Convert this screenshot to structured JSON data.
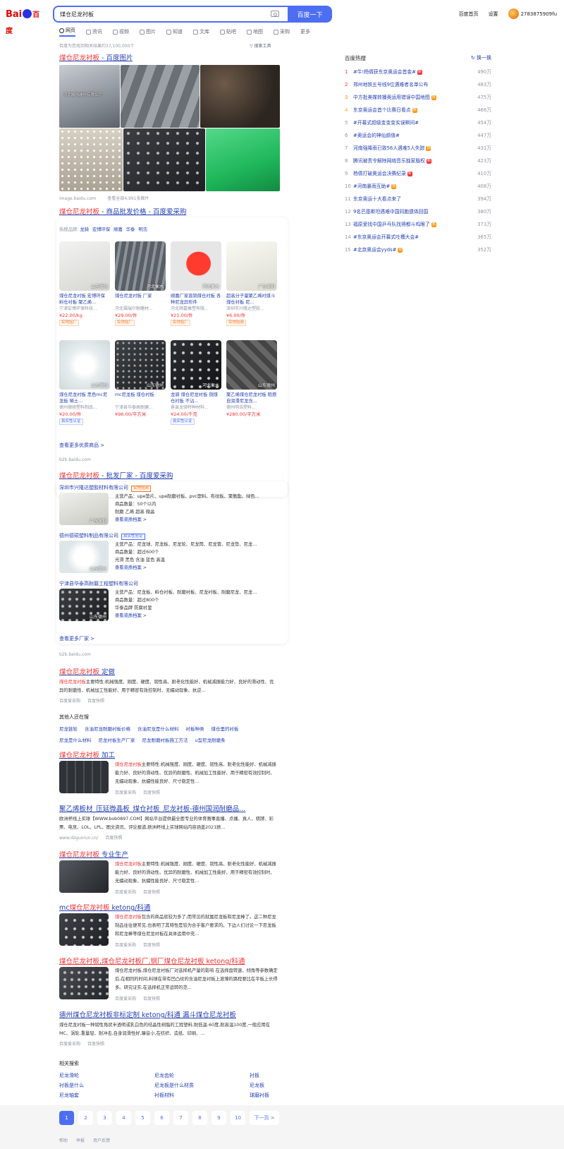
{
  "header": {
    "logo_bai": "Bai",
    "logo_du": "百度",
    "search_value": "煤仓尼龙衬板",
    "search_button": "百度一下",
    "links": [
      "百度首页",
      "设置"
    ],
    "user_name": "2783875909fu"
  },
  "tabs": [
    "网页",
    "资讯",
    "视频",
    "图片",
    "知道",
    "文库",
    "贴吧",
    "地图",
    "采购",
    "更多"
  ],
  "result_count": "百度为您找到相关结果约37,100,000个",
  "search_tools": "搜索工具",
  "image_result": {
    "title_em": "煤仓尼龙衬板",
    "title_rest": " - 百度图片",
    "source": "image.baidu.com",
    "more": "查看全部4,991张图片",
    "labels": [
      "河北曦扬建材有限公司",
      ""
    ]
  },
  "b2b_products": {
    "title_em": "煤仓尼龙衬板",
    "title_rest": " - 商品批发价格 - 百度爱采购",
    "brands_label": "热搜品牌:",
    "brands": [
      "龙骑",
      "宏博环保",
      "顺嘉",
      "华泰",
      "明浩"
    ],
    "cards": [
      {
        "title": "煤仓尼龙衬板 宏博环保 料仓衬板 聚乙烯...",
        "desc": "宁津宏博环保科技...",
        "price": "¥22.00/kg",
        "badge": "实地验厂",
        "badge_type": "orange",
        "loc": "山东德州"
      },
      {
        "title": "煤仓尼龙衬板 厂家",
        "desc": "河北福瑞尔耐磨材...",
        "price": "¥29.00/件",
        "badge": "实地验厂",
        "badge_type": "orange",
        "loc": "河北衡水"
      },
      {
        "title": "顺嘉厂家直销煤仓衬板 各种尼龙异形件",
        "desc": "河北顺嘉橡塑有限...",
        "price": "¥21.00/件",
        "badge": "实地验厂",
        "badge_type": "orange",
        "loc": "河北衡水"
      },
      {
        "title": "超高分子量聚乙烯衬煤斗煤仓衬板 尼...",
        "desc": "深圳市兴隆达塑胶...",
        "price": "¥6.00/件",
        "badge": "实地验商",
        "badge_type": "orange",
        "loc": "广东深圳"
      },
      {
        "title": "煤仓尼龙衬板 黑色mc尼龙板 稀土...",
        "desc": "德州德硕塑料制品...",
        "price": "¥20.00/件",
        "badge": "真实性认证",
        "badge_type": "blue",
        "loc": "山东德州"
      },
      {
        "title": "mc尼龙板 煤仓衬板",
        "desc": "宁津县华泰高耐磨...",
        "price": "¥96.00/平方米",
        "badge": "",
        "badge_type": "",
        "loc": "山东德州"
      },
      {
        "title": "龙骑 煤仓尼龙衬板 铜煤仓衬板 不沾...",
        "desc": "景县龙骑特种材料...",
        "price": "¥24.00/千克",
        "badge": "真实性认证",
        "badge_type": "blue",
        "loc": "河北衡水"
      },
      {
        "title": "聚乙烯煤仓尼龙衬板 阻燃自润滑尼龙含...",
        "desc": "德州明浩塑料...",
        "price": "¥280.00/平方米",
        "badge": "",
        "badge_type": "",
        "loc": "山东德州"
      }
    ],
    "more": "查看更多优质商品 >",
    "source": "b2b.baidu.com"
  },
  "b2b_vendors": {
    "title_em": "煤仓尼龙衬板",
    "title_rest": " - 批发厂家 - 百度爱采购",
    "vendors": [
      {
        "name": "深圳市兴隆达塑胶材料有限公司",
        "badge": "实地验商",
        "badge_type": "orange",
        "products": "主营产品：upe垫片、upe耐磨衬板、pvc塑料、布纹板、聚氨酯、绿色...",
        "count": "商品数量：50个以内",
        "tags": "耐磨    乙烯    超高    微晶",
        "more": "查看资质档案 >",
        "loc": "广东深圳"
      },
      {
        "name": "德州德硕塑料制品有限公司",
        "badge": "真实性验证",
        "badge_type": "blue",
        "products": "主营产品：尼龙球、尼龙板、尼龙轮、尼龙筒、尼龙管、尼龙垫、尼龙...",
        "count": "商品数量：超过600个",
        "tags": "光滑    黑色    含油    蓝色    高温",
        "more": "查看资质档案 >",
        "loc": "山东德州"
      },
      {
        "name": "宁津县华泰高耐磨工程塑料有限公司",
        "badge": "",
        "badge_type": "",
        "products": "主营产品：尼龙板、料仓衬板、耐磨衬板、尼龙衬板、耐磨尼龙、尼龙...",
        "count": "商品数量：超过800个",
        "tags": "华泰品牌    防腐衬里",
        "more": "查看资质档案 >",
        "loc": "山东德州"
      }
    ],
    "more": "查看更多厂家 >",
    "source": "b2b.baidu.com"
  },
  "result_custom": {
    "title_em": "煤仓尼龙衬板",
    "title_rest": " 定做",
    "text_em": "煤仓尼龙衬板",
    "text": "主要特性:机械强度、刚度、硬度、韧性高、耐老化性能好、机械减振能力好、良好的滑动性、优异的耐磨性、机械加工性能好、用于精密有效控制时、无蠕动现象、抗逆...",
    "source": "百度爱采购",
    "snapshot": "百度快照"
  },
  "others_searched": {
    "title": "其他人还在搜",
    "row1": [
      "尼龙链轮",
      "含油尼龙耐磨衬板价格",
      "含油尼龙是什么材料",
      "衬板种类",
      "煤仓里的衬板"
    ],
    "row2": [
      "尼龙是什么材料",
      "尼龙衬板生产厂家",
      "尼龙耐磨衬板施工方法",
      "u型尼龙耐磨条"
    ]
  },
  "result_process": {
    "title_em": "煤仓尼龙衬板",
    "title_rest": " 加工",
    "text_em": "煤仓尼龙衬板",
    "text": "主要特性:机械强度、刚度、硬度、韧性高、耐老化性能好、机械减振能力好、良好的滑动性、优异的耐磨性、机械加工性能好、用于精密有效控制时、无蠕动现象、抗蠕性能良好、尺寸稳定性...",
    "source": "百度爱采购",
    "snapshot": "百度快照"
  },
  "result_ad": {
    "title": "聚乙烯板材_压延微晶板_煤仓衬板_尼龙衬板-德州国润耐磨品...",
    "text": "欧洲杯线上买球【WWW.bob0897.COM】网站平台提供最全面专业的体育赛事直播、点播、真人、棋牌、彩票、电竞、LOL、LPL、图文资讯、评论报道,欧洲杯线上买球网站内容涵盖2021欧...",
    "source": "www.dzguorun.cn/",
    "snapshot": "百度快照"
  },
  "result_pro": {
    "title_em": "煤仓尼龙衬板",
    "title_rest": " 专业生产",
    "text_em": "煤仓尼龙衬板",
    "text": "主要特性:机械强度、刚度、硬度、韧性高、耐老化性能好、机械减振能力好、良好的滑动性、优异的耐磨性、机械加工性能好、用于精密有效控制时、无蠕动现象、抗蠕性能良好、尺寸稳定性...",
    "source": "百度爱采购",
    "snapshot": "百度快照"
  },
  "result_mc": {
    "title_pre": "mc",
    "title_em": "煤仓尼龙衬板",
    "title_rest": " ketong/科通",
    "text_em": "煤仓尼龙衬板",
    "text": "包含的商品就较为多了,而常见的就属尼龙板和尼龙棒了。这二种尼龙制品往往便常见,也表明了其特性是较为合乎客户要求的。下边人们讨论一下尼龙板和尼龙棒等煤仓尼龙衬板在具体运用中充...",
    "source": "百度爱采购",
    "snapshot": "百度快照"
  },
  "result_factory": {
    "title": "煤仓尼龙衬板,煤仓尼龙衬板厂,钢厂煤仓尼龙衬板 ketong/科通",
    "text": "煤仓尼龙衬板,煤仓尼龙衬板厂对选择机产量的影响 在选择盘转速、倾角等参数确定后,在相同的时间,料球在带有凹凸纹的含油尼龙衬板上滚薄的路程要比在平板上长得多。研究证实,在选择机正常运转的范...",
    "source": "百度爱采购",
    "snapshot": "百度快照"
  },
  "result_dezhou": {
    "title": "德州煤仓尼龙衬板非标定制 ketong/科通 漏斗煤仓尼龙衬板",
    "text": "煤仓尼龙衬板一种韧性角状半透明或乳白色的结晶性树脂的工程塑料,耐低温-60度,耐高温100度,一般应用在MC、涡轮,重量轻、耐冲击,自身润滑性好,噪音小,在纺织、造纸、印刷、...",
    "source": "百度爱采购",
    "snapshot": "百度快照"
  },
  "related": {
    "title": "相关搜索",
    "items": [
      "尼龙滑轮",
      "尼龙齿轮",
      "衬板",
      "衬板是什么",
      "尼龙板是什么材质",
      "尼龙板",
      "尼龙轴套",
      "衬板材料",
      "球磨衬板"
    ]
  },
  "hot_list": {
    "title": "百度热搜",
    "refresh": "换一换",
    "items": [
      {
        "rank": "1",
        "text": "#牛!杨倩获东京奥运会首金#",
        "tag": "新",
        "tag_type": "new",
        "count": "490万"
      },
      {
        "rank": "2",
        "text": "郑州地铁五号线9位遇难者名单公布",
        "tag": "",
        "tag_type": "",
        "count": "483万"
      },
      {
        "rank": "3",
        "text": "中方批美媒转播奥运用错误中国地图",
        "tag": "热",
        "tag_type": "hot",
        "count": "475万"
      },
      {
        "rank": "4",
        "text": "东京奥运会首个比赛日看点",
        "tag": "热",
        "tag_type": "hot",
        "count": "466万"
      },
      {
        "rank": "5",
        "text": "#开幕式超级变变变实误瞬间#",
        "tag": "",
        "tag_type": "",
        "count": "454万"
      },
      {
        "rank": "6",
        "text": "#奥运会的神仙颜值#",
        "tag": "",
        "tag_type": "",
        "count": "447万"
      },
      {
        "rank": "7",
        "text": "河南强降雨已致56人遇难5人失踪",
        "tag": "热",
        "tag_type": "hot",
        "count": "431万"
      },
      {
        "rank": "8",
        "text": "腾讯被责令解除网络音乐独家版权",
        "tag": "新",
        "tag_type": "new",
        "count": "423万"
      },
      {
        "rank": "9",
        "text": "杨倩打破奥运会决赛纪录",
        "tag": "新",
        "tag_type": "new",
        "count": "410万"
      },
      {
        "rank": "10",
        "text": "#河南暴雨互助#",
        "tag": "热",
        "tag_type": "hot",
        "count": "408万"
      },
      {
        "rank": "11",
        "text": "东京奥运十大看点来了",
        "tag": "",
        "tag_type": "",
        "count": "394万"
      },
      {
        "rank": "12",
        "text": "9名巴基斯坦遇难中国同胞遗体回国",
        "tag": "",
        "tag_type": "",
        "count": "380万"
      },
      {
        "rank": "13",
        "text": "福原爱找中国乒乓队找得都斗鸡眼了",
        "tag": "热",
        "tag_type": "hot",
        "count": "373万"
      },
      {
        "rank": "14",
        "text": "#东京奥运会开幕式吐槽大会#",
        "tag": "",
        "tag_type": "",
        "count": "365万"
      },
      {
        "rank": "15",
        "text": "#北京奥运会yyds#",
        "tag": "热",
        "tag_type": "hot",
        "count": "352万"
      }
    ]
  },
  "pager": {
    "pages": [
      "1",
      "2",
      "3",
      "4",
      "5",
      "6",
      "7",
      "8",
      "9",
      "10"
    ],
    "next": "下一页 >"
  },
  "footer": [
    "帮助",
    "举报",
    "用户反馈"
  ],
  "colors": {
    "accent": "#4e6ef2",
    "title_blue": "#2440b3",
    "highlight_red": "#f73131",
    "gray": "#9195a3"
  }
}
